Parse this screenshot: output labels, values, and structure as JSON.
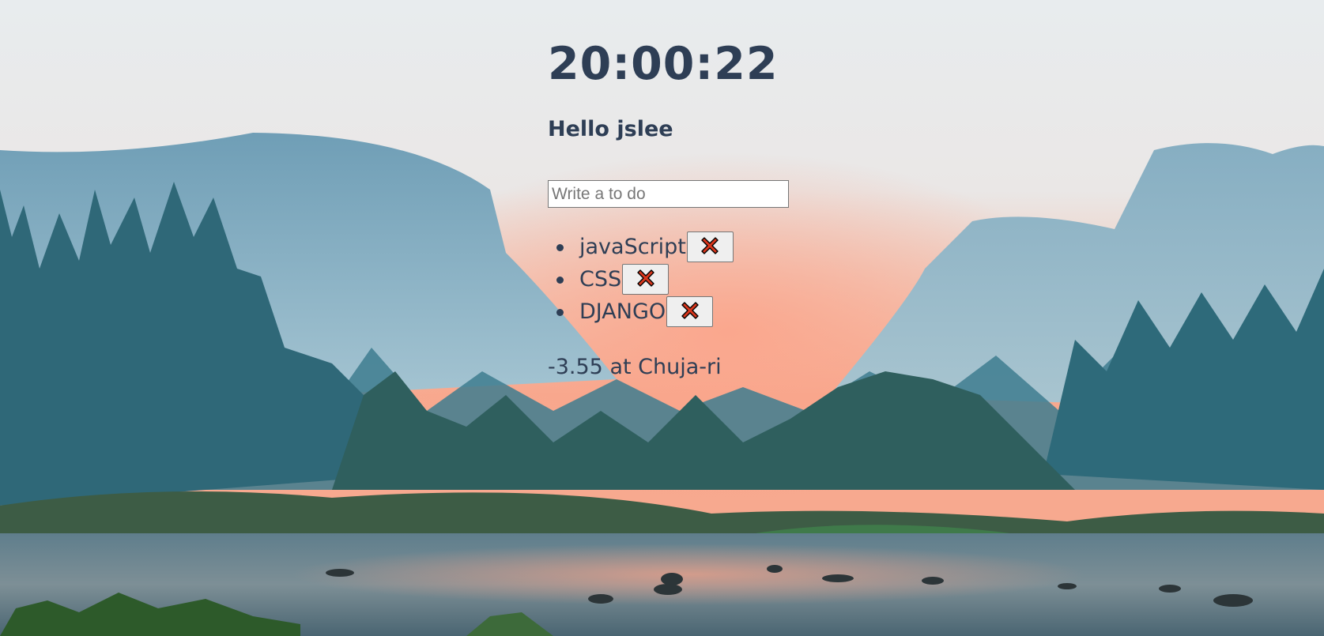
{
  "clock": {
    "time": "20:00:22"
  },
  "greeting": {
    "text": "Hello jslee"
  },
  "todo_form": {
    "placeholder": "Write a to do",
    "value": ""
  },
  "todos": [
    {
      "text": "javaScript",
      "delete_icon": "red-x-icon"
    },
    {
      "text": "CSS",
      "delete_icon": "red-x-icon"
    },
    {
      "text": "DJANGO",
      "delete_icon": "red-x-icon"
    }
  ],
  "weather": {
    "text": "-3.55 at Chuja-ri"
  },
  "background": {
    "subject": "mountain-valley-river-at-sunset"
  }
}
